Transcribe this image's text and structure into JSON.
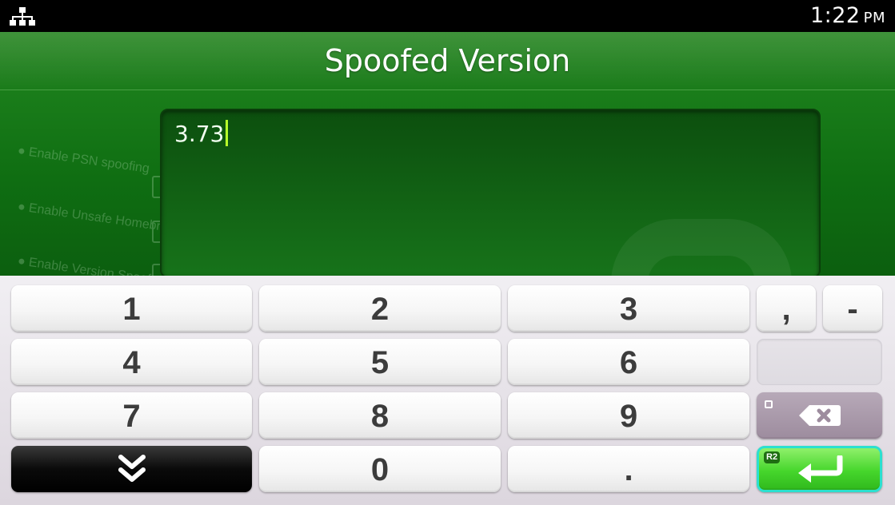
{
  "status_bar": {
    "network_icon": "network-icon",
    "time": "1:22",
    "ampm": "PM"
  },
  "dialog": {
    "title": "Spoofed Version",
    "input_value": "3.73"
  },
  "background_settings": [
    "Enable PSN spoofing",
    "Enable Unsafe Homebrew",
    "Enable Version Spoofing"
  ],
  "keyboard": {
    "keys": {
      "k1": "1",
      "k2": "2",
      "k3": "3",
      "k4": "4",
      "k5": "5",
      "k6": "6",
      "k7": "7",
      "k8": "8",
      "k9": "9",
      "k0": "0",
      "comma": ",",
      "minus": "-",
      "period": "."
    },
    "backspace_hint": "square-button-icon",
    "enter_hint": "R2",
    "hide_icon": "double-chevron-down-icon",
    "backspace_icon": "backspace-icon",
    "enter_icon": "enter-arrow-icon"
  },
  "colors": {
    "app_green": "#1a7d1a",
    "caret": "#b7ff2a",
    "enter_key": "#46d62c",
    "enter_border": "#2be0cf"
  }
}
